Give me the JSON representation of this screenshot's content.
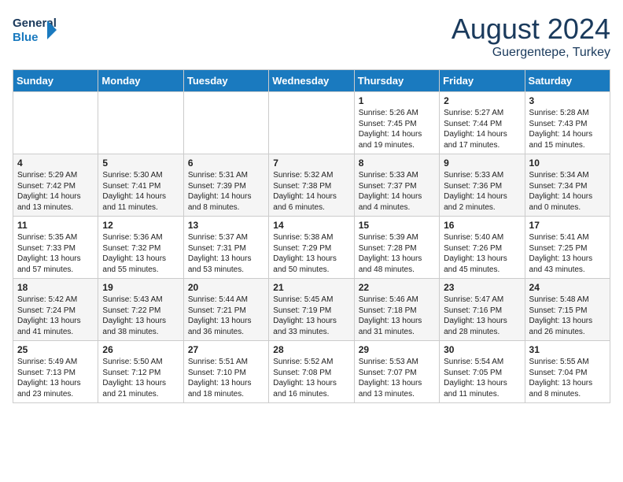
{
  "header": {
    "logo_line1": "General",
    "logo_line2": "Blue",
    "month": "August 2024",
    "location": "Guergentepe, Turkey"
  },
  "weekdays": [
    "Sunday",
    "Monday",
    "Tuesday",
    "Wednesday",
    "Thursday",
    "Friday",
    "Saturday"
  ],
  "weeks": [
    [
      {
        "day": "",
        "content": ""
      },
      {
        "day": "",
        "content": ""
      },
      {
        "day": "",
        "content": ""
      },
      {
        "day": "",
        "content": ""
      },
      {
        "day": "1",
        "content": "Sunrise: 5:26 AM\nSunset: 7:45 PM\nDaylight: 14 hours\nand 19 minutes."
      },
      {
        "day": "2",
        "content": "Sunrise: 5:27 AM\nSunset: 7:44 PM\nDaylight: 14 hours\nand 17 minutes."
      },
      {
        "day": "3",
        "content": "Sunrise: 5:28 AM\nSunset: 7:43 PM\nDaylight: 14 hours\nand 15 minutes."
      }
    ],
    [
      {
        "day": "4",
        "content": "Sunrise: 5:29 AM\nSunset: 7:42 PM\nDaylight: 14 hours\nand 13 minutes."
      },
      {
        "day": "5",
        "content": "Sunrise: 5:30 AM\nSunset: 7:41 PM\nDaylight: 14 hours\nand 11 minutes."
      },
      {
        "day": "6",
        "content": "Sunrise: 5:31 AM\nSunset: 7:39 PM\nDaylight: 14 hours\nand 8 minutes."
      },
      {
        "day": "7",
        "content": "Sunrise: 5:32 AM\nSunset: 7:38 PM\nDaylight: 14 hours\nand 6 minutes."
      },
      {
        "day": "8",
        "content": "Sunrise: 5:33 AM\nSunset: 7:37 PM\nDaylight: 14 hours\nand 4 minutes."
      },
      {
        "day": "9",
        "content": "Sunrise: 5:33 AM\nSunset: 7:36 PM\nDaylight: 14 hours\nand 2 minutes."
      },
      {
        "day": "10",
        "content": "Sunrise: 5:34 AM\nSunset: 7:34 PM\nDaylight: 14 hours\nand 0 minutes."
      }
    ],
    [
      {
        "day": "11",
        "content": "Sunrise: 5:35 AM\nSunset: 7:33 PM\nDaylight: 13 hours\nand 57 minutes."
      },
      {
        "day": "12",
        "content": "Sunrise: 5:36 AM\nSunset: 7:32 PM\nDaylight: 13 hours\nand 55 minutes."
      },
      {
        "day": "13",
        "content": "Sunrise: 5:37 AM\nSunset: 7:31 PM\nDaylight: 13 hours\nand 53 minutes."
      },
      {
        "day": "14",
        "content": "Sunrise: 5:38 AM\nSunset: 7:29 PM\nDaylight: 13 hours\nand 50 minutes."
      },
      {
        "day": "15",
        "content": "Sunrise: 5:39 AM\nSunset: 7:28 PM\nDaylight: 13 hours\nand 48 minutes."
      },
      {
        "day": "16",
        "content": "Sunrise: 5:40 AM\nSunset: 7:26 PM\nDaylight: 13 hours\nand 45 minutes."
      },
      {
        "day": "17",
        "content": "Sunrise: 5:41 AM\nSunset: 7:25 PM\nDaylight: 13 hours\nand 43 minutes."
      }
    ],
    [
      {
        "day": "18",
        "content": "Sunrise: 5:42 AM\nSunset: 7:24 PM\nDaylight: 13 hours\nand 41 minutes."
      },
      {
        "day": "19",
        "content": "Sunrise: 5:43 AM\nSunset: 7:22 PM\nDaylight: 13 hours\nand 38 minutes."
      },
      {
        "day": "20",
        "content": "Sunrise: 5:44 AM\nSunset: 7:21 PM\nDaylight: 13 hours\nand 36 minutes."
      },
      {
        "day": "21",
        "content": "Sunrise: 5:45 AM\nSunset: 7:19 PM\nDaylight: 13 hours\nand 33 minutes."
      },
      {
        "day": "22",
        "content": "Sunrise: 5:46 AM\nSunset: 7:18 PM\nDaylight: 13 hours\nand 31 minutes."
      },
      {
        "day": "23",
        "content": "Sunrise: 5:47 AM\nSunset: 7:16 PM\nDaylight: 13 hours\nand 28 minutes."
      },
      {
        "day": "24",
        "content": "Sunrise: 5:48 AM\nSunset: 7:15 PM\nDaylight: 13 hours\nand 26 minutes."
      }
    ],
    [
      {
        "day": "25",
        "content": "Sunrise: 5:49 AM\nSunset: 7:13 PM\nDaylight: 13 hours\nand 23 minutes."
      },
      {
        "day": "26",
        "content": "Sunrise: 5:50 AM\nSunset: 7:12 PM\nDaylight: 13 hours\nand 21 minutes."
      },
      {
        "day": "27",
        "content": "Sunrise: 5:51 AM\nSunset: 7:10 PM\nDaylight: 13 hours\nand 18 minutes."
      },
      {
        "day": "28",
        "content": "Sunrise: 5:52 AM\nSunset: 7:08 PM\nDaylight: 13 hours\nand 16 minutes."
      },
      {
        "day": "29",
        "content": "Sunrise: 5:53 AM\nSunset: 7:07 PM\nDaylight: 13 hours\nand 13 minutes."
      },
      {
        "day": "30",
        "content": "Sunrise: 5:54 AM\nSunset: 7:05 PM\nDaylight: 13 hours\nand 11 minutes."
      },
      {
        "day": "31",
        "content": "Sunrise: 5:55 AM\nSunset: 7:04 PM\nDaylight: 13 hours\nand 8 minutes."
      }
    ]
  ]
}
